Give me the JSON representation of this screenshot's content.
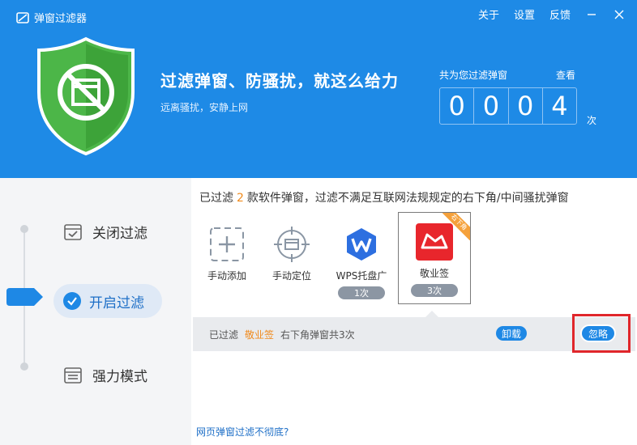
{
  "app": {
    "title": "弹窗过滤器"
  },
  "top_menu": {
    "about": "关于",
    "settings": "设置",
    "feedback": "反馈"
  },
  "hero": {
    "slogan": "过滤弹窗、防骚扰，就这么给力",
    "subtitle": "远离骚扰，安静上网",
    "counter_title": "共为您过滤弹窗",
    "counter_view": "查看",
    "digits": [
      "0",
      "0",
      "0",
      "4"
    ],
    "counter_unit": "次"
  },
  "modes": {
    "off": "关闭过滤",
    "on": "开启过滤",
    "strong": "强力模式"
  },
  "summary": {
    "prefix": "已过滤",
    "count": "2",
    "suffix": "款软件弹窗，过滤不满足互联网法规规定的右下角/中间骚扰弹窗"
  },
  "tiles": [
    {
      "label": "手动添加",
      "icon": "add-icon"
    },
    {
      "label": "手动定位",
      "icon": "crosshair-icon"
    },
    {
      "label": "WPS托盘广",
      "count": "1次",
      "icon": "wps-icon"
    },
    {
      "label": "敬业签",
      "count": "3次",
      "icon": "jingyeqian-icon",
      "tag": "右下角"
    }
  ],
  "detail": {
    "prefix": "已过滤",
    "app": "敬业签",
    "suffix": "右下角弹窗共3次",
    "uninstall": "卸载",
    "ignore": "忽略"
  },
  "footer": {
    "web_link": "网页弹窗过滤不彻底?"
  },
  "colors": {
    "header": "#1e8ae6",
    "accent": "#1e88e5",
    "orange": "#f08a1c",
    "highlight": "#e0262b"
  }
}
